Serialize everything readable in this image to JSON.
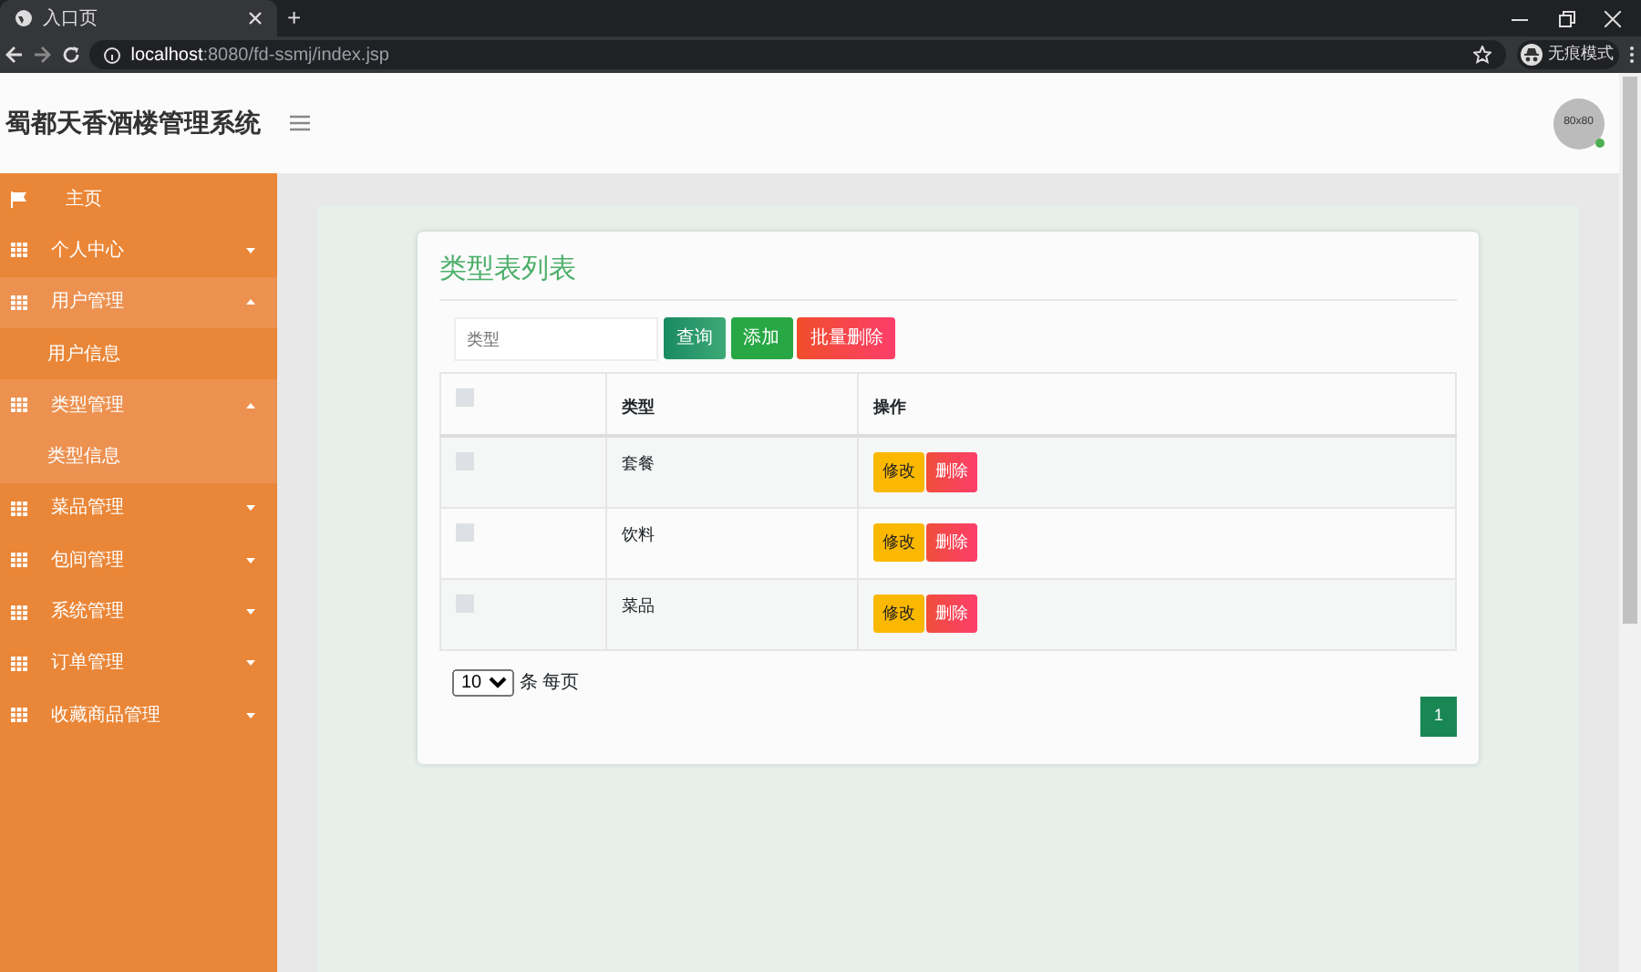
{
  "browser": {
    "tab_title": "入口页",
    "new_tab": "+",
    "url_host": "localhost",
    "url_path": ":8080/fd-ssmj/index.jsp",
    "profile": "无痕模式"
  },
  "header": {
    "title": "蜀都天香酒楼管理系统",
    "avatar_text": "80x80"
  },
  "sidebar": {
    "items": [
      {
        "kind": "home",
        "label": "主页"
      },
      {
        "kind": "group",
        "label": "个人中心",
        "expanded": false
      },
      {
        "kind": "group",
        "label": "用户管理",
        "expanded": true,
        "children": [
          {
            "label": "用户信息"
          }
        ]
      },
      {
        "kind": "group",
        "label": "类型管理",
        "expanded": true,
        "children": [
          {
            "label": "类型信息"
          }
        ]
      },
      {
        "kind": "group",
        "label": "菜品管理",
        "expanded": false
      },
      {
        "kind": "group",
        "label": "包间管理",
        "expanded": false
      },
      {
        "kind": "group",
        "label": "系统管理",
        "expanded": false
      },
      {
        "kind": "group",
        "label": "订单管理",
        "expanded": false
      },
      {
        "kind": "group",
        "label": "收藏商品管理",
        "expanded": false
      }
    ]
  },
  "card": {
    "title": "类型表列表",
    "search": {
      "placeholder": "类型"
    },
    "buttons": [
      {
        "kind": "search",
        "label": "查询"
      },
      {
        "kind": "add",
        "label": "添加"
      },
      {
        "kind": "delete",
        "label": "批量删除"
      }
    ],
    "table": {
      "all_checked": false,
      "columns": [
        "类型",
        "操作"
      ],
      "rows": [
        {
          "checked": false,
          "type": "套餐",
          "actions": [
            "修改",
            "删除"
          ]
        },
        {
          "checked": false,
          "type": "饮料",
          "actions": [
            "修改",
            "删除"
          ]
        },
        {
          "checked": false,
          "type": "菜品",
          "actions": [
            "修改",
            "删除"
          ]
        }
      ]
    },
    "page_size": "10",
    "page_size_label": "条 每页",
    "pages": [
      {
        "label": "1",
        "selected": true
      }
    ]
  }
}
